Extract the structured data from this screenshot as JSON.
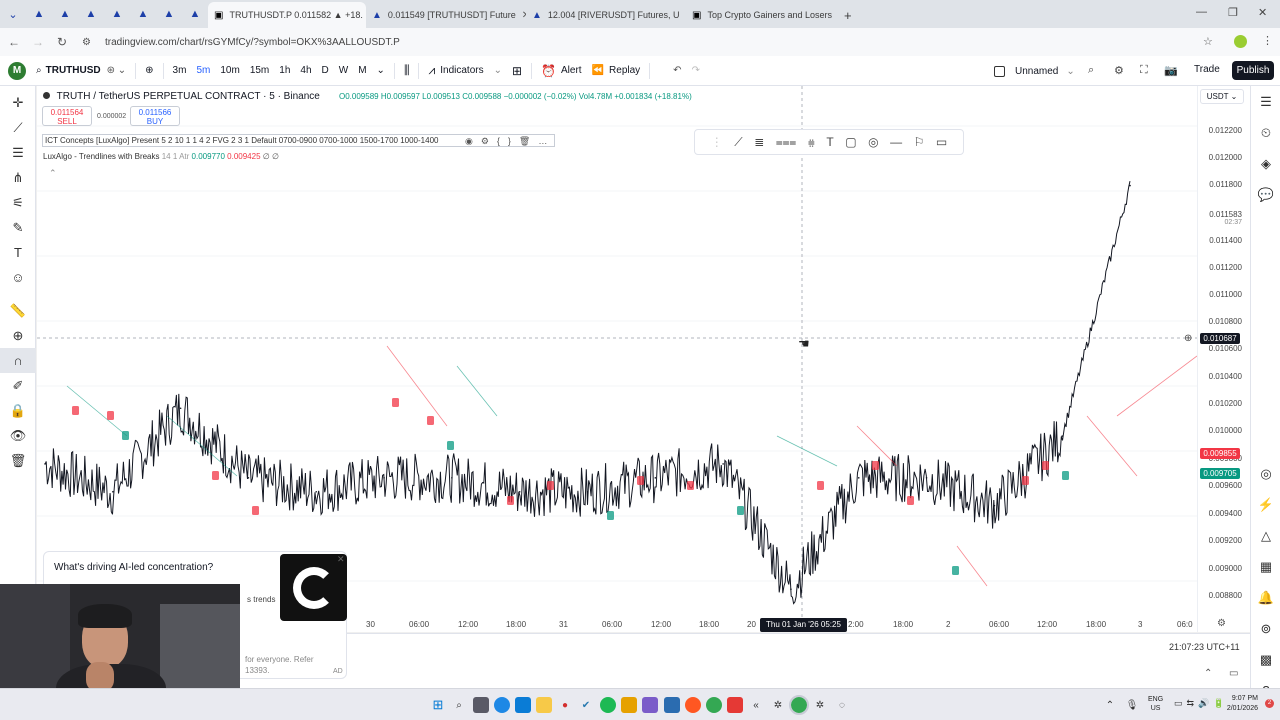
{
  "browser": {
    "tabs": [
      {
        "title": "TRUTHUSDT.P 0.011582 ▲ +18.",
        "active": true
      },
      {
        "title": "0.011549 [TRUTHUSDT] Future"
      },
      {
        "title": "12.004 [RIVERUSDT] Futures, U"
      },
      {
        "title": "Top Crypto Gainers and Losers"
      }
    ],
    "url": "tradingview.com/chart/rsGYMfCy/?symbol=OKX%3AALLOUSDT.P"
  },
  "toolbar": {
    "symbol": "TRUTHUSD",
    "intervals": [
      "3m",
      "5m",
      "10m",
      "15m",
      "1h",
      "4h",
      "D",
      "W",
      "M"
    ],
    "indicators_label": "Indicators",
    "alert_label": "Alert",
    "replay_label": "Replay",
    "layout_name": "Unnamed",
    "trade_label": "Trade",
    "publish_label": "Publish"
  },
  "legend": {
    "title": "TRUTH / TetherUS PERPETUAL CONTRACT · 5 · Binance",
    "ohlc": "O0.009589 H0.009597 L0.009513 C0.009588 −0.000002 (−0.02%) Vol4.78M +0.001834 (+18.81%)",
    "sell_price": "0.011564",
    "sell_label": "SELL",
    "spread": "0.000002",
    "buy_price": "0.011566",
    "buy_label": "BUY",
    "indicator1": "ICT Concepts [LuxAlgo] Present 5 2 10 1 1 4 2 FVG 2 3 1 Default 0700-0900 0700-1000 1500-1700 1000-1400",
    "indicator2": "LuxAlgo - Trendlines with Breaks",
    "indicator2_params": "14 1 Atr",
    "indicator2_v1": "0.009770",
    "indicator2_v2": "0.009425",
    "indicator2_v3": "∅ ∅"
  },
  "price_axis": {
    "currency": "USDT",
    "labels": [
      "0.012200",
      "0.012000",
      "0.011800",
      "0.011583",
      "02:37",
      "0.011400",
      "0.011200",
      "0.011000",
      "0.010800",
      "0.010600",
      "0.010400",
      "0.010200",
      "0.010000",
      "0.009800",
      "0.009600",
      "0.009400",
      "0.009200",
      "0.009000",
      "0.008800"
    ],
    "crosshair_price": "0.010687",
    "red_label": "0.009855",
    "green_label": "0.009705"
  },
  "time_axis": {
    "labels": [
      "30",
      "06:00",
      "12:00",
      "18:00",
      "31",
      "06:00",
      "12:00",
      "18:00",
      "20",
      "2:00",
      "18:00",
      "2",
      "06:00",
      "12:00",
      "18:00",
      "3",
      "06:0"
    ],
    "crosshair_time": "Thu 01 Jan '26  05:25",
    "clock": "21:07:23 UTC+11"
  },
  "ad": {
    "headline": "What's driving AI-led concentration?",
    "snippet1": "s trends",
    "snippet2": "for everyone. Refer",
    "snippet3": "13393.",
    "ad_badge": "AD"
  },
  "taskbar": {
    "lang": "ENG",
    "region": "US",
    "time": "9:07 PM",
    "date": "2/01/2026"
  },
  "colors": {
    "up": "#089981",
    "down": "#f23645",
    "accent": "#2962ff"
  },
  "chart_data": {
    "type": "line",
    "title": "",
    "x": [
      "30",
      "06:00",
      "12:00",
      "18:00",
      "31",
      "06:00",
      "12:00",
      "18:00",
      "Thu 01 Jan '26",
      "06:00",
      "12:00",
      "18:00",
      "2",
      "06:00",
      "12:00",
      "18:00",
      "3"
    ],
    "series": [
      {
        "name": "",
        "values": [
          0.0098,
          0.0096,
          0.0102,
          0.0097,
          0.0096,
          0.0097,
          0.0097,
          0.0096,
          0.0096,
          0.0097,
          0.0098,
          0.0089,
          0.0097,
          0.0097,
          0.0095,
          0.01,
          0.0118
        ]
      }
    ],
    "ylim": [
      0.0087,
      0.0123
    ]
  }
}
